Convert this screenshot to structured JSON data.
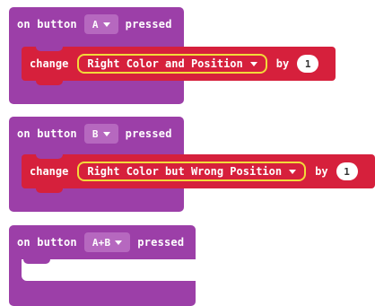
{
  "blocks": [
    {
      "event_prefix": "on button",
      "button": "A",
      "event_suffix": "pressed",
      "statement": {
        "keyword": "change",
        "variable": "Right Color and Position",
        "by_label": "by",
        "value": "1"
      }
    },
    {
      "event_prefix": "on button",
      "button": "B",
      "event_suffix": "pressed",
      "statement": {
        "keyword": "change",
        "variable": "Right Color but Wrong Position",
        "by_label": "by",
        "value": "1"
      }
    },
    {
      "event_prefix": "on button",
      "button": "A+B",
      "event_suffix": "pressed"
    }
  ],
  "colors": {
    "event_block": "#9c3fa8",
    "event_dropdown": "#b668bf",
    "statement_block": "#d6203c",
    "highlight_outline": "#f2da3a"
  },
  "icons": [
    "chevron-down-icon"
  ]
}
